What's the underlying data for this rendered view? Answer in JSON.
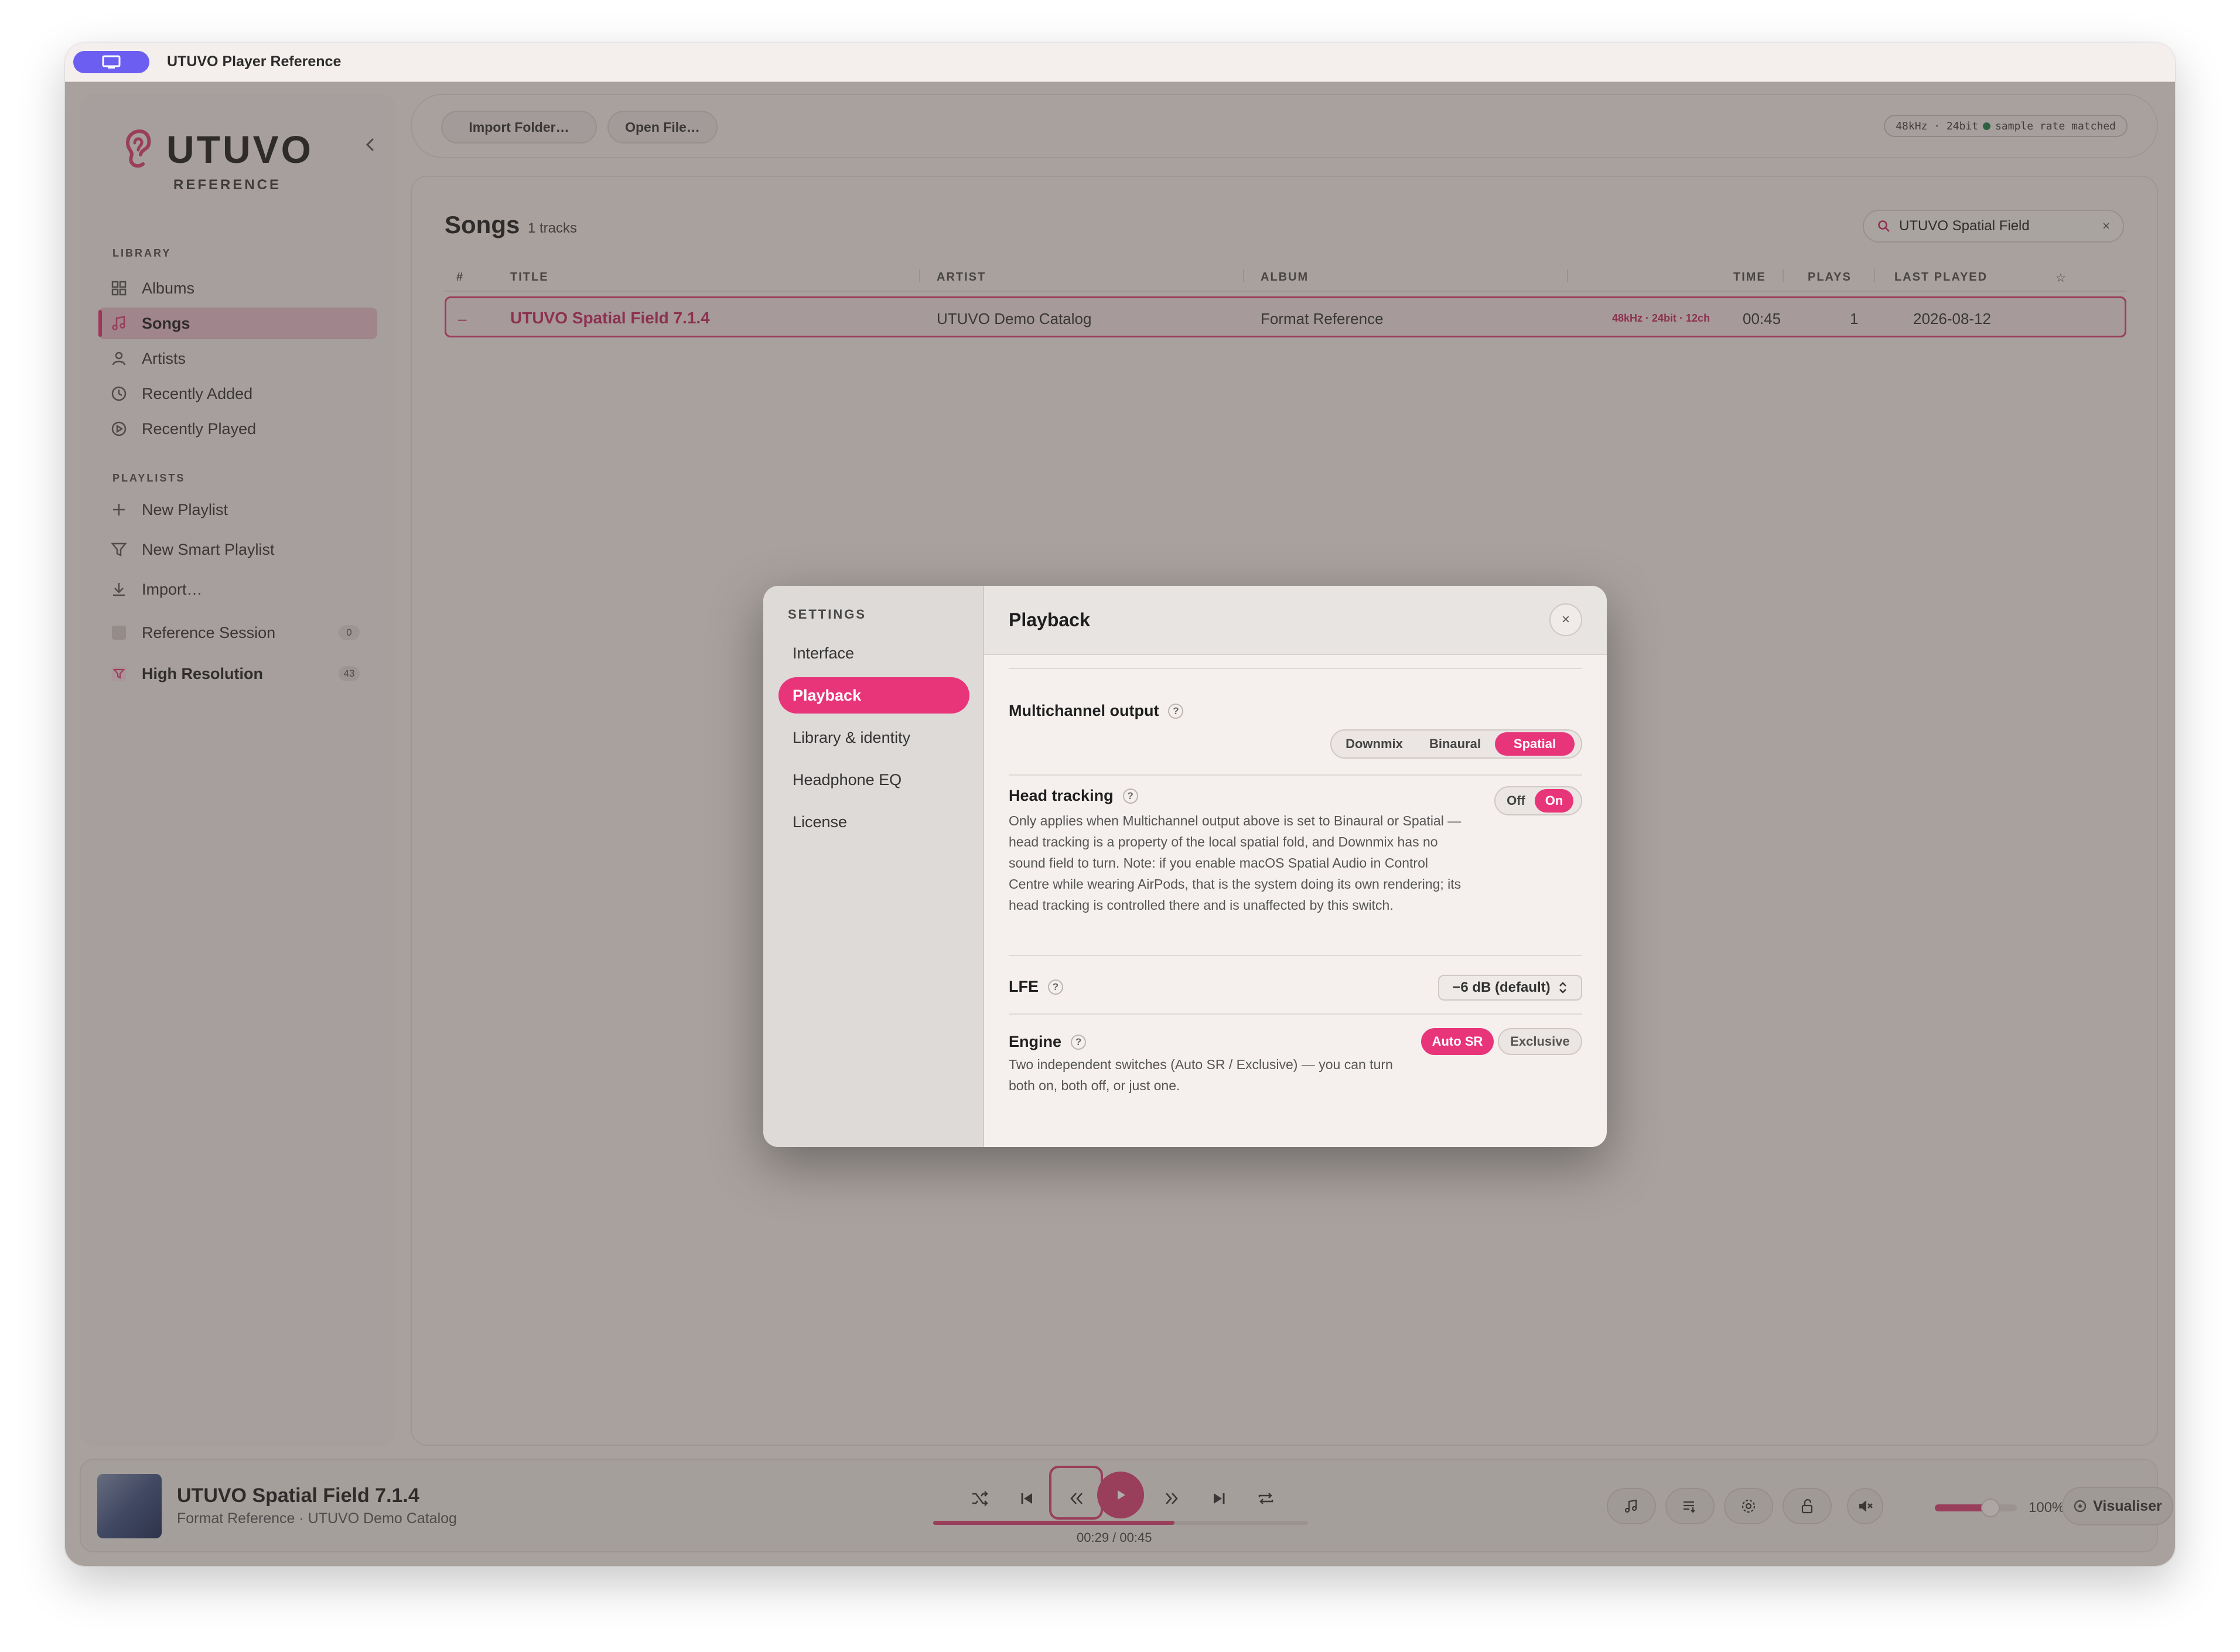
{
  "window": {
    "title": "UTUVO Player Reference"
  },
  "sidebar": {
    "logo_word": "UTUVO",
    "logo_sub": "REFERENCE",
    "collapse_icon": "chevron-left-icon",
    "library_label": "LIBRARY",
    "library_items": [
      {
        "label": "Albums",
        "icon": "grid-icon"
      },
      {
        "label": "Songs",
        "icon": "music-note-icon",
        "active": true
      },
      {
        "label": "Artists",
        "icon": "person-icon"
      },
      {
        "label": "Recently Added",
        "icon": "clock-icon"
      },
      {
        "label": "Recently Played",
        "icon": "play-circle-icon"
      }
    ],
    "playlists_label": "PLAYLISTS",
    "playlist_actions": [
      {
        "label": "New Playlist",
        "icon": "plus-icon"
      },
      {
        "label": "New Smart Playlist",
        "icon": "filter-icon"
      },
      {
        "label": "Import…",
        "icon": "download-icon"
      }
    ],
    "playlists": [
      {
        "label": "Reference Session",
        "count": "0"
      },
      {
        "label": "High Resolution",
        "count": "43"
      }
    ]
  },
  "toolbar": {
    "import_folder": "Import Folder…",
    "open_file": "Open File…",
    "sample_rate": "48kHz · 24bit",
    "sample_rate_status": "sample rate matched"
  },
  "songs": {
    "title": "Songs",
    "count": "1 tracks",
    "search_value": "UTUVO Spatial Field",
    "columns": [
      "#",
      "TITLE",
      "ARTIST",
      "ALBUM",
      "TIME",
      "PLAYS",
      "LAST PLAYED"
    ],
    "rows": [
      {
        "num": "–",
        "title": "UTUVO Spatial Field 7.1.4",
        "artist": "UTUVO Demo Catalog",
        "album": "Format Reference",
        "format": "48kHz · 24bit · 12ch",
        "time": "00:45",
        "plays": "1",
        "last_played": "2026-08-12"
      }
    ]
  },
  "settings": {
    "sidebar_label": "SETTINGS",
    "nav": [
      "Interface",
      "Playback",
      "Library & identity",
      "Headphone EQ",
      "License"
    ],
    "active_nav": "Playback",
    "title": "Playback",
    "close": "×",
    "multichannel": {
      "label": "Multichannel output",
      "options": [
        "Downmix",
        "Binaural",
        "Spatial"
      ],
      "selected": "Spatial"
    },
    "head_tracking": {
      "label": "Head tracking",
      "off": "Off",
      "on": "On",
      "value": "On",
      "description": "Only applies when Multichannel output above is set to Binaural or Spatial — head tracking is a property of the local spatial fold, and Downmix has no sound field to turn. Note: if you enable macOS Spatial Audio in Control Centre while wearing AirPods, that is the system doing its own rendering; its head tracking is controlled there and is unaffected by this switch."
    },
    "lfe": {
      "label": "LFE",
      "value": "−6 dB (default)"
    },
    "engine": {
      "label": "Engine",
      "auto_sr": "Auto SR",
      "exclusive": "Exclusive",
      "description": "Two independent switches (Auto SR / Exclusive) — you can turn both on, both off, or just one."
    }
  },
  "player": {
    "title": "UTUVO Spatial Field 7.1.4",
    "subtitle": "Format Reference · UTUVO Demo Catalog",
    "time": "00:29 / 00:45",
    "progress": 0.644,
    "volume_pct": "100%",
    "volume": 0.68,
    "visualiser": "Visualiser"
  },
  "colors": {
    "accent": "#e8357a",
    "accent_dark": "#c2285f",
    "window_pill": "#6d5ef2"
  }
}
